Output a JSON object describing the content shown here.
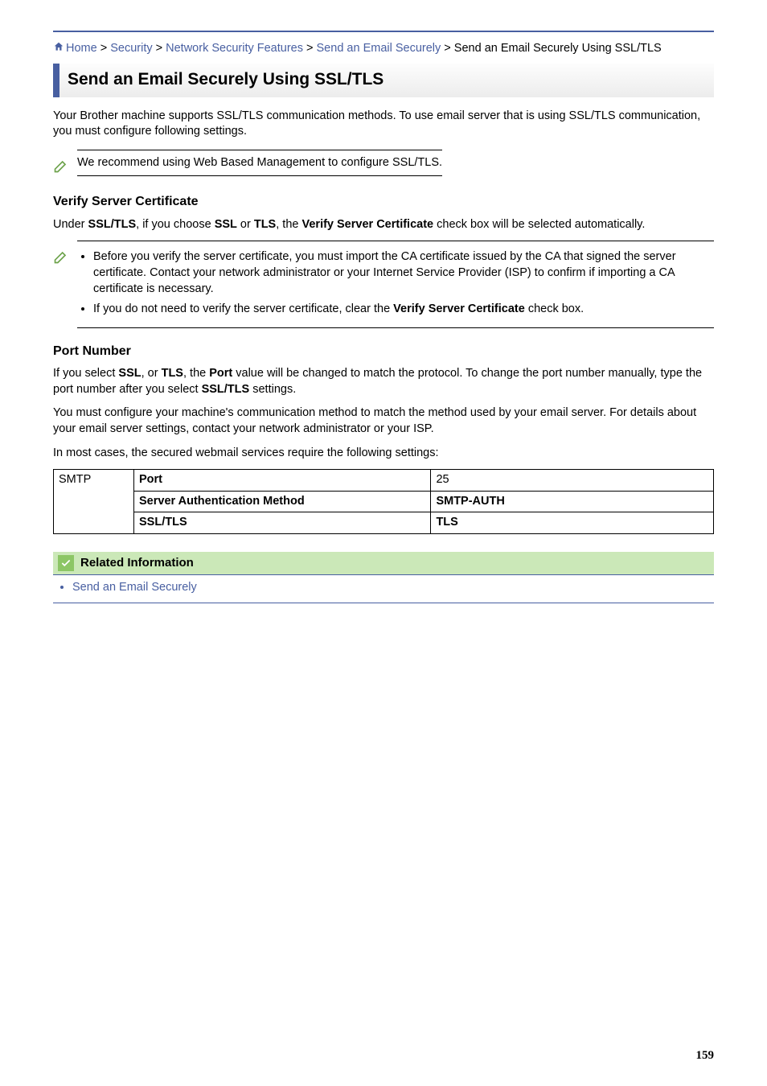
{
  "breadcrumb": {
    "home": "Home",
    "sep": " > ",
    "security": "Security",
    "netsec": "Network Security Features",
    "sendsec": "Send an Email Securely",
    "current": "Send an Email Securely Using SSL/TLS"
  },
  "title": "Send an Email Securely Using SSL/TLS",
  "intro": "Your Brother machine supports SSL/TLS communication methods. To use email server that is using SSL/TLS communication, you must configure following settings.",
  "note_recommend": "We recommend using Web Based Management to configure SSL/TLS.",
  "verify": {
    "heading": "Verify Server Certificate",
    "para_pre": "Under ",
    "b1": "SSL/TLS",
    "para_mid1": ", if you choose ",
    "b2": "SSL",
    "or": " or ",
    "b3": "TLS",
    "para_mid2": ", the ",
    "b4": "Verify Server Certificate",
    "para_end": " check box will be selected automatically.",
    "bullets": [
      "Before you verify the server certificate, you must import the CA certificate issued by the CA that signed the server certificate. Contact your network administrator or your Internet Service Provider (ISP) to confirm if importing a CA certificate is necessary.",
      {
        "pre": "If you do not need to verify the server certificate, clear the ",
        "b": "Verify Server Certificate",
        "post": " check box."
      }
    ]
  },
  "port": {
    "heading": "Port Number",
    "p1_pre": "If you select ",
    "p1_b1": "SSL",
    "p1_mid1": ", or ",
    "p1_b2": "TLS",
    "p1_mid2": ", the ",
    "p1_b3": "Port",
    "p1_mid3": " value will be changed to match the protocol. To change the port number manually, type the port number after you select ",
    "p1_b4": "SSL/TLS",
    "p1_end": " settings.",
    "p2": "You must configure your machine's communication method to match the method used by your email server. For details about your email server settings, contact your network administrator or your ISP.",
    "p3": "In most cases, the secured webmail services require the following settings:"
  },
  "table": {
    "smtp": "SMTP",
    "rows": [
      {
        "label": "Port",
        "value": "25"
      },
      {
        "label": "Server Authentication Method",
        "value": "SMTP-AUTH"
      },
      {
        "label": "SSL/TLS",
        "value": "TLS"
      }
    ]
  },
  "related": {
    "title": "Related Information",
    "items": [
      "Send an Email Securely"
    ]
  },
  "page_number": "159"
}
